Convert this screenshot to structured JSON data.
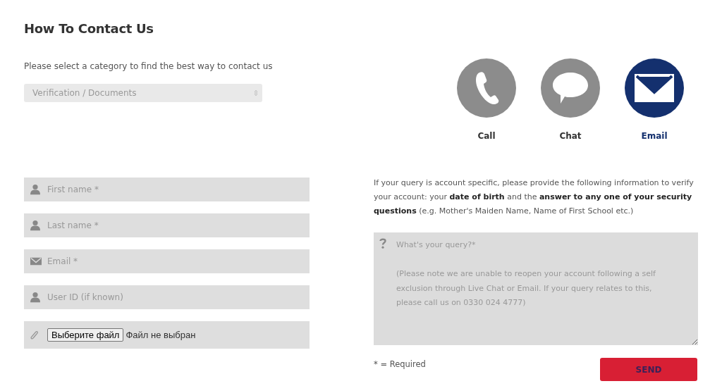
{
  "title": "How To Contact Us",
  "category": {
    "prompt": "Please select a category to find the best way to contact us",
    "value": "Verification / Documents"
  },
  "methods": [
    {
      "kind": "call",
      "label": "Call",
      "selected": false
    },
    {
      "kind": "chat",
      "label": "Chat",
      "selected": false
    },
    {
      "kind": "email",
      "label": "Email",
      "selected": true
    }
  ],
  "fields": [
    {
      "kind": "person",
      "placeholder": "First name *"
    },
    {
      "kind": "person",
      "placeholder": "Last name *"
    },
    {
      "kind": "email",
      "placeholder": "Email *"
    },
    {
      "kind": "person",
      "placeholder": "User ID (if known)"
    }
  ],
  "attachment": {
    "button": "Выберите файл",
    "status": "Файл не выбран"
  },
  "info": "If your query is account specific, please provide the following information to verify your account: your **date of birth** and the **answer to any one of your security questions** (e.g. Mother's Maiden Name, Name of First School etc.)",
  "query": {
    "placeholder": "What's your query?*\n\n(Please note we are unable to reopen your account following a self exclusion through Live Chat or Email. If your query relates to this, please call us on 0330 024 4777)"
  },
  "required_note": "* = Required",
  "send": "SEND"
}
